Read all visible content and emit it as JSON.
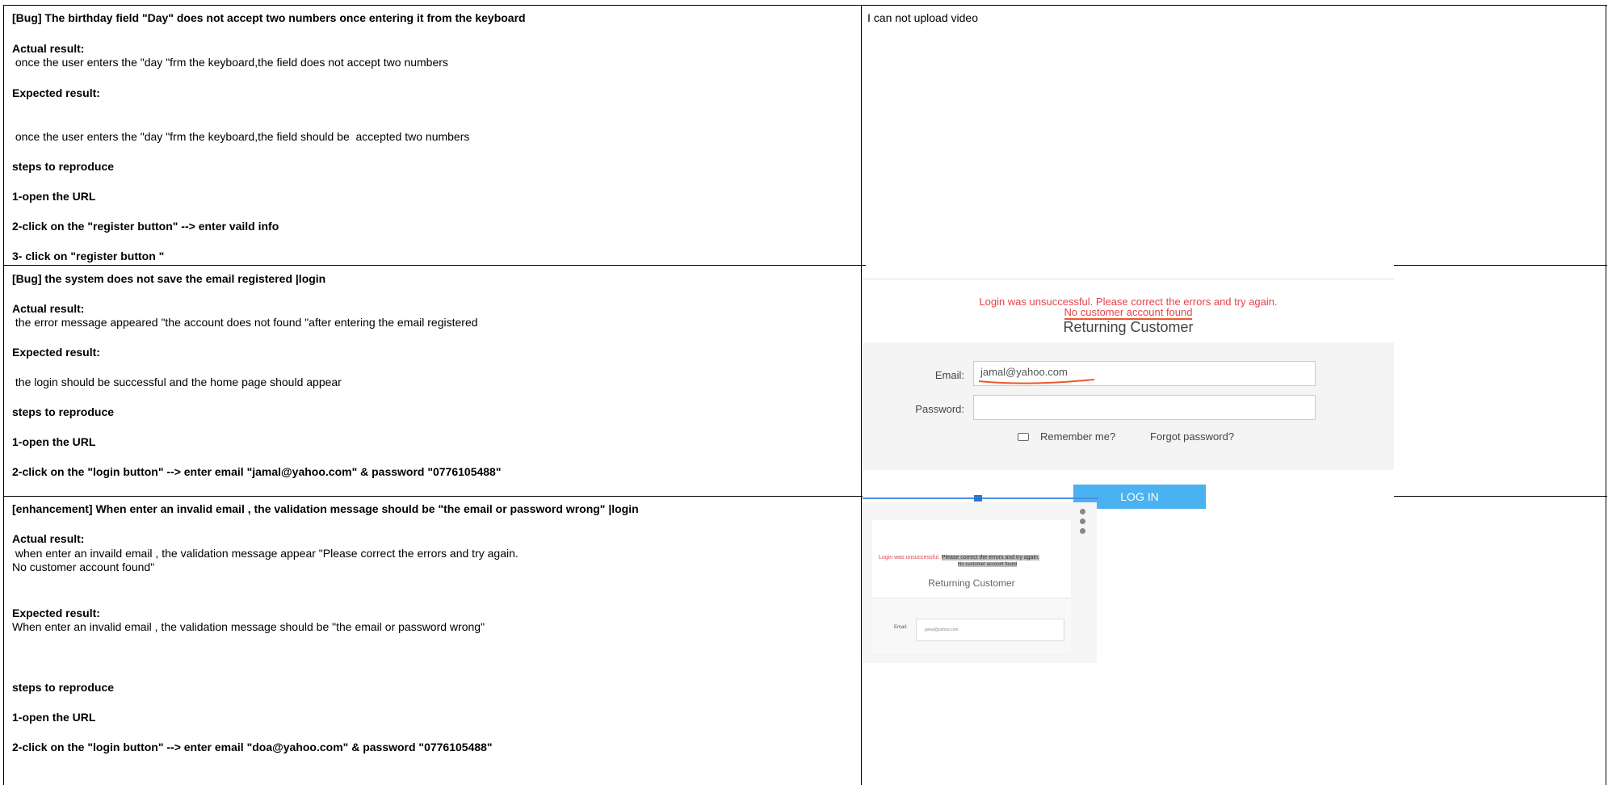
{
  "rows": [
    {
      "lines": [
        {
          "text": "[Bug] The birthday field \"Day\" does not accept two numbers once entering it from the keyboard",
          "bold": true
        },
        {
          "text": "Actual result:",
          "bold": true
        },
        {
          "text": " once the user enters the \"day \"frm the keyboard,the field does not accept two numbers",
          "bold": false
        },
        {
          "text": "Expected result:",
          "bold": true
        },
        {
          "text": " once the user enters the \"day \"frm the keyboard,the field should be  accepted two numbers",
          "bold": false
        },
        {
          "text": "steps to reproduce",
          "bold": true
        },
        {
          "text": "1-open the URL",
          "bold": true
        },
        {
          "text": "2-click on the \"register button\" --> enter vaild info",
          "bold": true
        },
        {
          "text": "3- click on \"register button \"",
          "bold": true
        }
      ],
      "note": "I can not upload video"
    },
    {
      "lines": [
        {
          "text": "[Bug] the system does not save the email registered |login",
          "bold": true
        },
        {
          "text": "Actual result:",
          "bold": true
        },
        {
          "text": " the error message appeared \"the account does not found \"after entering the email registered",
          "bold": false
        },
        {
          "text": "Expected result:",
          "bold": true
        },
        {
          "text": " the login should be successful and the home page should appear",
          "bold": false
        },
        {
          "text": "steps to reproduce",
          "bold": true
        },
        {
          "text": "1-open the URL",
          "bold": true
        },
        {
          "text": "2-click on the \"login button\" --> enter email \"jamal@yahoo.com\" & password \"0776105488\"",
          "bold": true
        }
      ]
    },
    {
      "lines": [
        {
          "text": "[enhancement] When enter an invalid email , the validation message should be \"the email or password wrong\" |login",
          "bold": true
        },
        {
          "text": "Actual result:",
          "bold": true
        },
        {
          "text": " when enter an invaild email , the validation message appear \"Please correct the errors and try again.",
          "bold": false
        },
        {
          "text": "No customer account found\"",
          "bold": false
        },
        {
          "text": "Expected result:",
          "bold": true
        },
        {
          "text": "When enter an invalid email , the validation message should be \"the email or password wrong\"",
          "bold": false
        },
        {
          "text": "steps to reproduce",
          "bold": true
        },
        {
          "text": "1-open the URL",
          "bold": true
        },
        {
          "text": "2-click on the \"login button\" --> enter email \"doa@yahoo.com\" & password \"0776105488\"",
          "bold": true
        }
      ]
    }
  ],
  "screenshot_login": {
    "error_line1": "Login was unsuccessful. Please correct the errors and try again.",
    "error_line2": "No customer account found",
    "heading": "Returning Customer",
    "email_label": "Email:",
    "email_value": "jamal@yahoo.com",
    "password_label": "Password:",
    "remember_label": "Remember me?",
    "forgot_label": "Forgot password?",
    "login_button": "LOG IN"
  },
  "screenshot_small": {
    "error_part1": "Login was unsuccessful.",
    "error_part2": "Please correct the errors and try again.",
    "error_line2": "No customer account found",
    "heading": "Returning Customer",
    "email_label": "Email:",
    "email_value": "jamal@yahoo.com"
  },
  "colors": {
    "error_red": "#e4434b",
    "login_blue": "#4ab2f1",
    "underline_orange": "#e8592c"
  }
}
